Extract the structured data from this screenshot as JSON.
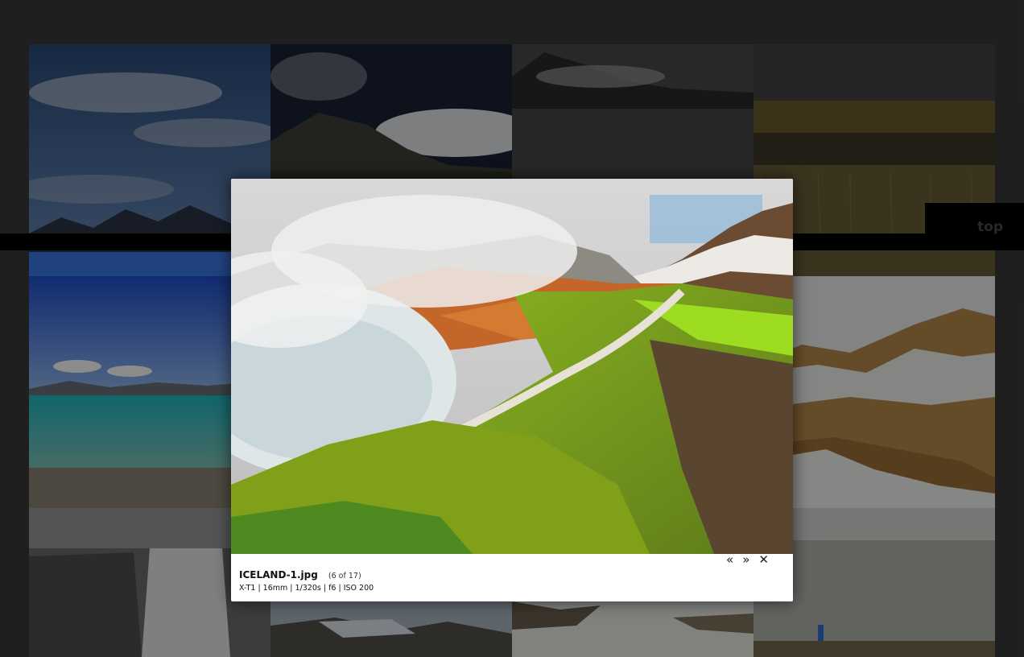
{
  "top_button": {
    "label": "top"
  },
  "lightbox": {
    "filename": "ICELAND-1.jpg",
    "counter": "(6 of 17)",
    "exif": "X-T1 | 16mm | 1/320s | f6 | ISO 200",
    "prev_icon": "«",
    "next_icon": "»",
    "close_icon": "✕"
  },
  "gallery": {
    "thumbnails": [
      "blue-sky-mountains",
      "dark-mountain-clouds",
      "misty-mountain-bw",
      "reed-lake-reflection",
      "turquoise-lake-shore",
      "snowy-hills-hikers",
      "waterfall-bw",
      "glacier-valley",
      "snowfield-hikers",
      "snowy-slope-hiker"
    ]
  }
}
